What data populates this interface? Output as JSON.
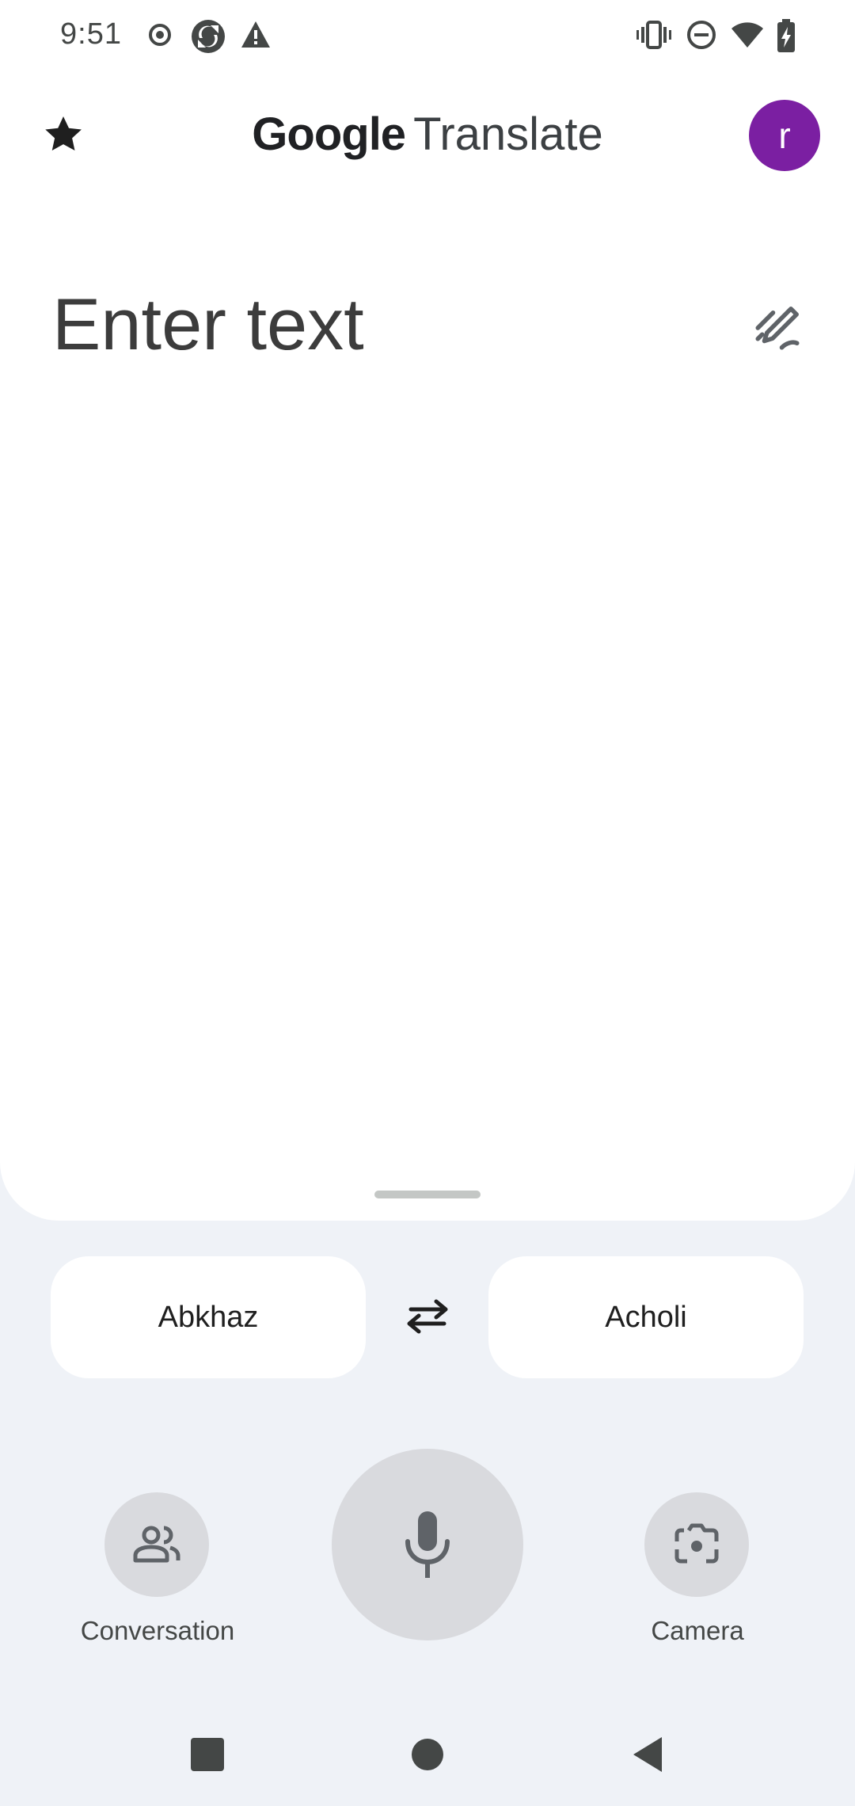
{
  "status_bar": {
    "time": "9:51",
    "left_icons": [
      "record-icon",
      "sync-icon",
      "warning-icon"
    ],
    "right_icons": [
      "vibrate-icon",
      "do-not-disturb-icon",
      "wifi-icon",
      "battery-charging-icon"
    ]
  },
  "header": {
    "favorites_icon": "star-icon",
    "logo_google": "Google",
    "logo_product": "Translate",
    "avatar_letter": "r",
    "avatar_color": "#7b1fa2"
  },
  "input": {
    "placeholder": "Enter text",
    "handwriting_icon": "handwriting-pen-icon"
  },
  "languages": {
    "source": "Abkhaz",
    "target": "Acholi",
    "swap_icon": "swap-arrows-icon"
  },
  "actions": {
    "conversation_label": "Conversation",
    "camera_label": "Camera",
    "mic_icon": "microphone-icon"
  },
  "nav_bar": {
    "icons": [
      "recents-icon",
      "home-icon",
      "back-icon"
    ]
  },
  "colors": {
    "background": "#eff2f7",
    "sheet": "#ffffff",
    "button_gray": "#d9dade",
    "icon_gray": "#5f6368"
  }
}
